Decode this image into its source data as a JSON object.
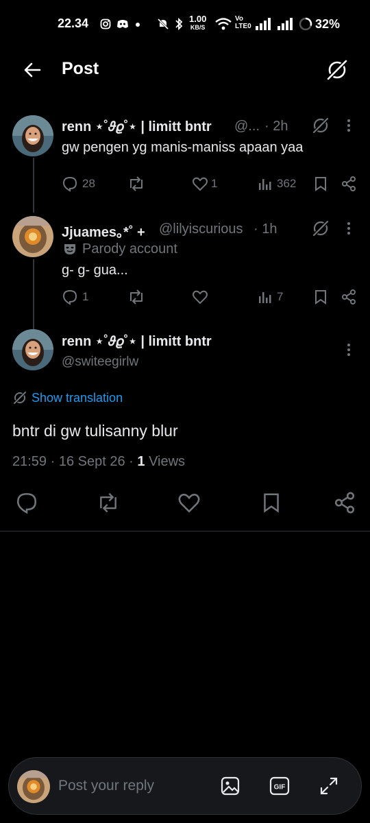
{
  "status_bar": {
    "time": "22.34",
    "net_speed": "1.00",
    "net_unit": "KB/S",
    "volte": "Vo",
    "lte": "LTE0",
    "battery": "32%"
  },
  "header": {
    "title": "Post"
  },
  "tweets": [
    {
      "name": "renn ⋆˚𝜗𝜚˚⋆ | limitt bntr",
      "handle": "@...",
      "time": "· 2h",
      "text": "gw pengen yg manis-maniss apaan yaa",
      "stats": {
        "replies": "28",
        "retweets": "",
        "likes": "1",
        "views": "362"
      }
    },
    {
      "name": "Jjuames｡*˚ +",
      "handle": "@lilyiscurious",
      "time": "· 1h",
      "parody_label": "Parody account",
      "text": "g- g- gua...",
      "stats": {
        "replies": "1",
        "retweets": "",
        "likes": "",
        "views": "7"
      }
    }
  ],
  "main_post": {
    "name": "renn ⋆˚𝜗𝜚˚⋆ | limitt bntr",
    "handle": "@switeegirlw",
    "show_translation": "Show translation",
    "text": "bntr di gw tulisanny blur",
    "time": "21:59",
    "date": "· 16 Sept 26 ·",
    "views_count": "1",
    "views_label": "Views"
  },
  "reply": {
    "placeholder": "Post your reply"
  },
  "colors": {
    "accent": "#1d9bf0",
    "muted": "#71767b",
    "background": "#000000"
  }
}
